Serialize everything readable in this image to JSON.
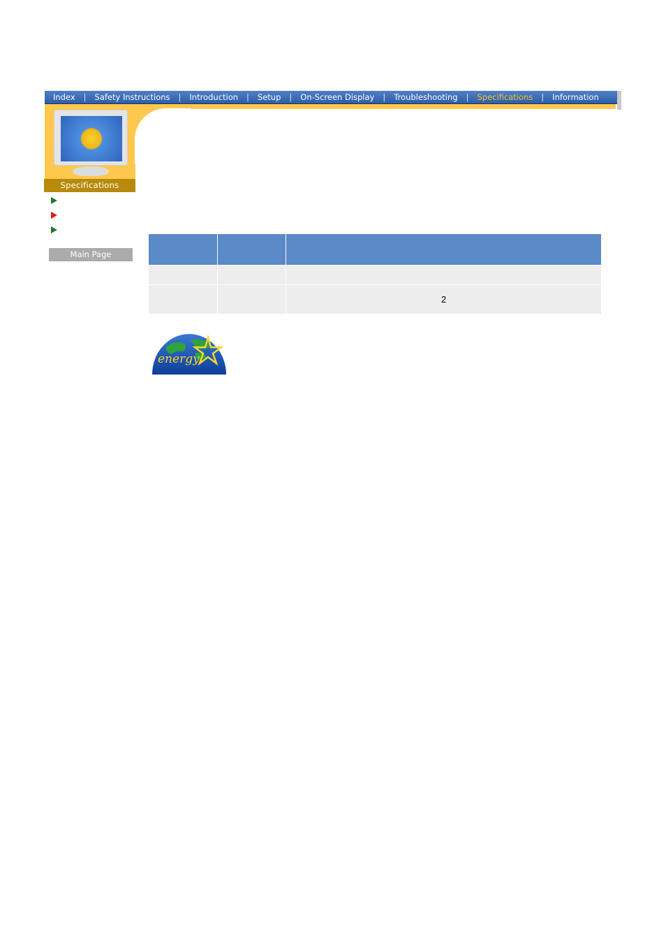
{
  "nav": {
    "items": [
      {
        "label": "Index",
        "active": false
      },
      {
        "label": "Safety Instructions",
        "active": false
      },
      {
        "label": "Introduction",
        "active": false
      },
      {
        "label": "Setup",
        "active": false
      },
      {
        "label": "On-Screen Display",
        "active": false
      },
      {
        "label": "Troubleshooting",
        "active": false
      },
      {
        "label": "Specifications",
        "active": true
      },
      {
        "label": "Information",
        "active": false
      }
    ],
    "separator": "|",
    "active_color": "#f5c52a"
  },
  "sidebar": {
    "section_label": "Specifications",
    "links": [
      {
        "label": "",
        "icon": "green-arrow-icon",
        "color": "#1e7a2a"
      },
      {
        "label": "",
        "icon": "red-arrow-icon",
        "color": "#e21b1b"
      },
      {
        "label": "",
        "icon": "green-arrow-icon",
        "color": "#1e7a2a"
      }
    ],
    "main_page_label": "Main Page"
  },
  "table": {
    "headers": [
      "",
      "",
      ""
    ],
    "rows": [
      [
        "",
        "",
        ""
      ],
      [
        "",
        "",
        "2"
      ]
    ],
    "header_color": "#5a8ac8",
    "cell_color": "#ededed"
  },
  "logo": {
    "name": "energy-star-logo",
    "text": "energy"
  }
}
